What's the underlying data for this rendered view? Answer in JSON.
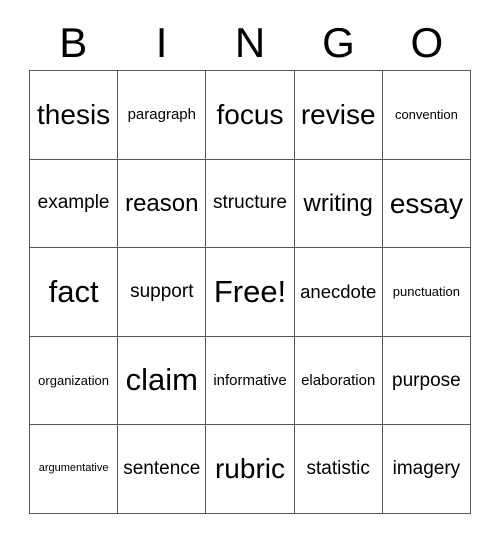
{
  "card": {
    "title_letters": [
      "B",
      "I",
      "N",
      "G",
      "O"
    ],
    "grid": {
      "rows": [
        [
          {
            "text": "thesis",
            "size": "fs-xl"
          },
          {
            "text": "paragraph",
            "size": "fs-sm"
          },
          {
            "text": "focus",
            "size": "fs-xl"
          },
          {
            "text": "revise",
            "size": "fs-xl"
          },
          {
            "text": "convention",
            "size": "fs-xs"
          }
        ],
        [
          {
            "text": "example",
            "size": "fs-md"
          },
          {
            "text": "reason",
            "size": "fs-lg"
          },
          {
            "text": "structure",
            "size": "fs-md"
          },
          {
            "text": "writing",
            "size": "fs-lg"
          },
          {
            "text": "essay",
            "size": "fs-xl"
          }
        ],
        [
          {
            "text": "fact",
            "size": "fs-xxl"
          },
          {
            "text": "support",
            "size": "fs-md"
          },
          {
            "text": "Free!",
            "size": "fs-xxl"
          },
          {
            "text": "anecdote",
            "size": "fs-md"
          },
          {
            "text": "punctuation",
            "size": "fs-xs"
          }
        ],
        [
          {
            "text": "organization",
            "size": "fs-xs"
          },
          {
            "text": "claim",
            "size": "fs-xxl"
          },
          {
            "text": "informative",
            "size": "fs-sm"
          },
          {
            "text": "elaboration",
            "size": "fs-sm"
          },
          {
            "text": "purpose",
            "size": "fs-md"
          }
        ],
        [
          {
            "text": "argumentative",
            "size": "fs-xxs"
          },
          {
            "text": "sentence",
            "size": "fs-md"
          },
          {
            "text": "rubric",
            "size": "fs-xl"
          },
          {
            "text": "statistic",
            "size": "fs-md"
          },
          {
            "text": "imagery",
            "size": "fs-md"
          }
        ]
      ]
    },
    "colors": {
      "background": "#ffffff",
      "text": "#000000",
      "grid_line": "#58585a"
    }
  }
}
